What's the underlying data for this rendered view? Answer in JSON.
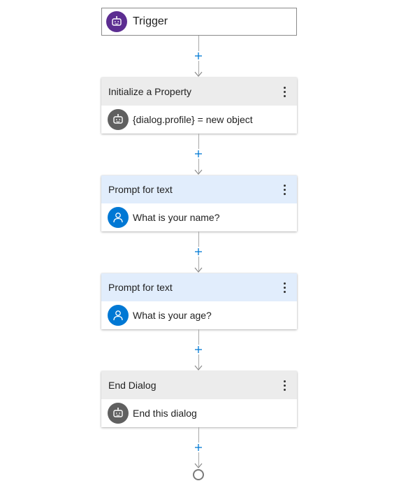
{
  "trigger": {
    "label": "Trigger",
    "icon": "bot-icon",
    "icon_color": "#5c2d91"
  },
  "actions": [
    {
      "title": "Initialize a Property",
      "body": "{dialog.profile} = new object",
      "icon": "bot-icon",
      "header_color": "#ececec",
      "icon_color": "#606060"
    },
    {
      "title": "Prompt for text",
      "body": "What is your name?",
      "icon": "user-icon",
      "header_color": "#e1edfc",
      "icon_color": "#0078d4"
    },
    {
      "title": "Prompt for text",
      "body": "What is your age?",
      "icon": "user-icon",
      "header_color": "#e1edfc",
      "icon_color": "#0078d4"
    },
    {
      "title": "End Dialog",
      "body": "End this dialog",
      "icon": "bot-icon",
      "header_color": "#ececec",
      "icon_color": "#606060"
    }
  ],
  "add_button_icon": "plus-icon",
  "accent_color": "#0078d4"
}
